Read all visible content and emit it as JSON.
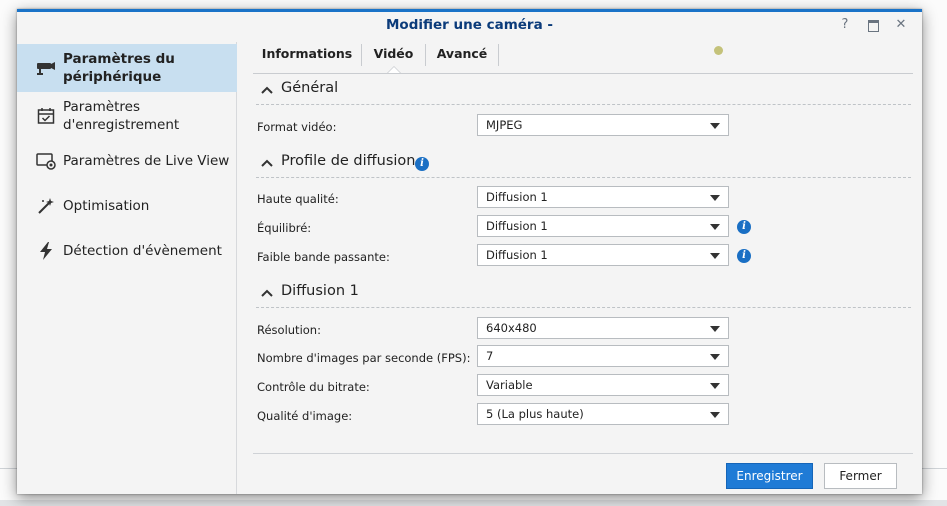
{
  "window": {
    "title": "Modifier une caméra -",
    "controls": [
      "help-icon",
      "maximize-icon",
      "close-icon"
    ]
  },
  "sidebar": {
    "items": [
      {
        "label": "Paramètres du périphérique",
        "icon": "camera-icon",
        "active": true
      },
      {
        "label": "Paramètres d'enregistrement",
        "icon": "calendar-icon",
        "active": false
      },
      {
        "label": "Paramètres de Live View",
        "icon": "liveview-icon",
        "active": false
      },
      {
        "label": "Optimisation",
        "icon": "magic-wand-icon",
        "active": false
      },
      {
        "label": "Détection d'évènement",
        "icon": "lightning-icon",
        "active": false
      }
    ]
  },
  "tabs": [
    {
      "label": "Informations",
      "active": false
    },
    {
      "label": "Vidéo",
      "active": true
    },
    {
      "label": "Avancé",
      "active": false
    }
  ],
  "sections": {
    "general": {
      "title": "Général",
      "format_label": "Format vidéo:",
      "format_value": "MJPEG"
    },
    "profile": {
      "title": "Profile de diffusion",
      "rows": [
        {
          "label": "Haute qualité:",
          "value": "Diffusion 1"
        },
        {
          "label": "Équilibré:",
          "value": "Diffusion 1"
        },
        {
          "label": "Faible bande passante:",
          "value": "Diffusion 1"
        }
      ]
    },
    "diffusion": {
      "title": "Diffusion 1",
      "rows": [
        {
          "label": "Résolution:",
          "value": "640x480"
        },
        {
          "label": "Nombre d'images par seconde (FPS):",
          "value": "7"
        },
        {
          "label": "Contrôle du bitrate:",
          "value": "Variable"
        },
        {
          "label": "Qualité d'image:",
          "value": "5 (La plus haute)"
        }
      ]
    }
  },
  "footer": {
    "save_label": "Enregistrer",
    "close_label": "Fermer"
  },
  "colors": {
    "accent": "#1f7bd6",
    "title": "#0b3b7a",
    "sidebar_active": "#c8dff0",
    "status_dot": "#c4c27a"
  }
}
